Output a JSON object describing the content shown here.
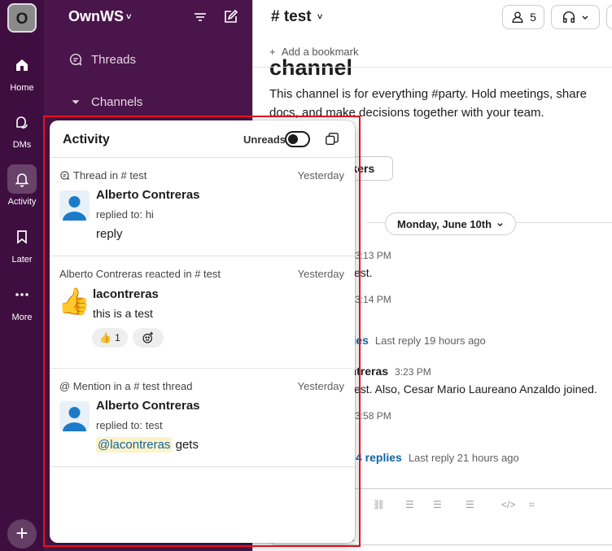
{
  "rail": {
    "workspace_initial": "O",
    "items": [
      {
        "label": "Home",
        "icon": "home-icon",
        "active": false
      },
      {
        "label": "DMs",
        "icon": "dms-icon",
        "active": false
      },
      {
        "label": "Activity",
        "icon": "bell-icon",
        "active": true
      },
      {
        "label": "Later",
        "icon": "bookmark-icon",
        "active": false
      },
      {
        "label": "More",
        "icon": "more-icon",
        "active": false
      }
    ],
    "add_label": "+"
  },
  "sidebar": {
    "workspace_name": "OwnWS",
    "workspace_caret": "˅",
    "threads": "Threads",
    "channels": "Channels"
  },
  "channel": {
    "title": "# test",
    "caret": "˅",
    "member_count": "5",
    "add_bookmark": "Add a bookmark",
    "big_title": "channel",
    "description": "This channel is for everything #party. Hold meetings, share docs, and make decisions together with your team.",
    "partial_button": "rkers",
    "date_divider": "Monday, June 10th",
    "messages": [
      {
        "name": "ras",
        "time": "3:13 PM"
      },
      {
        "text": "est."
      },
      {
        "name": "ras",
        "time": "3:14 PM"
      },
      {
        "replies": "plies",
        "last": "Last reply 19 hours ago"
      },
      {
        "name": "ontreras",
        "time": "3:23 PM"
      },
      {
        "text": "est. Also, Cesar Mario Laureano Anzaldo joined."
      },
      {
        "name": "ras",
        "time": "3:58 PM"
      },
      {
        "replies": "4 replies",
        "last": "Last reply 21 hours ago"
      }
    ],
    "composer_placeholder": "est"
  },
  "activity": {
    "title": "Activity",
    "unreads_label": "Unreads",
    "unreads_on": false,
    "items": [
      {
        "context": "Thread in # test",
        "time": "Yesterday",
        "author": "Alberto Contreras",
        "subtitle": "replied to: hi",
        "body": "reply"
      },
      {
        "context": "Alberto Contreras reacted in # test",
        "time": "Yesterday",
        "author": "lacontreras",
        "body": "this is a test",
        "emoji": "👍",
        "reaction_emoji": "👍",
        "reaction_count": "1"
      },
      {
        "context": "@ Mention in a # test thread",
        "time": "Yesterday",
        "author": "Alberto Contreras",
        "subtitle": "replied to: test",
        "mention": "@lacontreras",
        "body_after": "gets"
      }
    ]
  },
  "colors": {
    "rail_bg": "#3f0e40",
    "sidebar_bg": "#4a154b",
    "link_blue": "#1264a3",
    "highlight_red": "#e0141e",
    "avatar_blue": "#1d7ac8"
  }
}
